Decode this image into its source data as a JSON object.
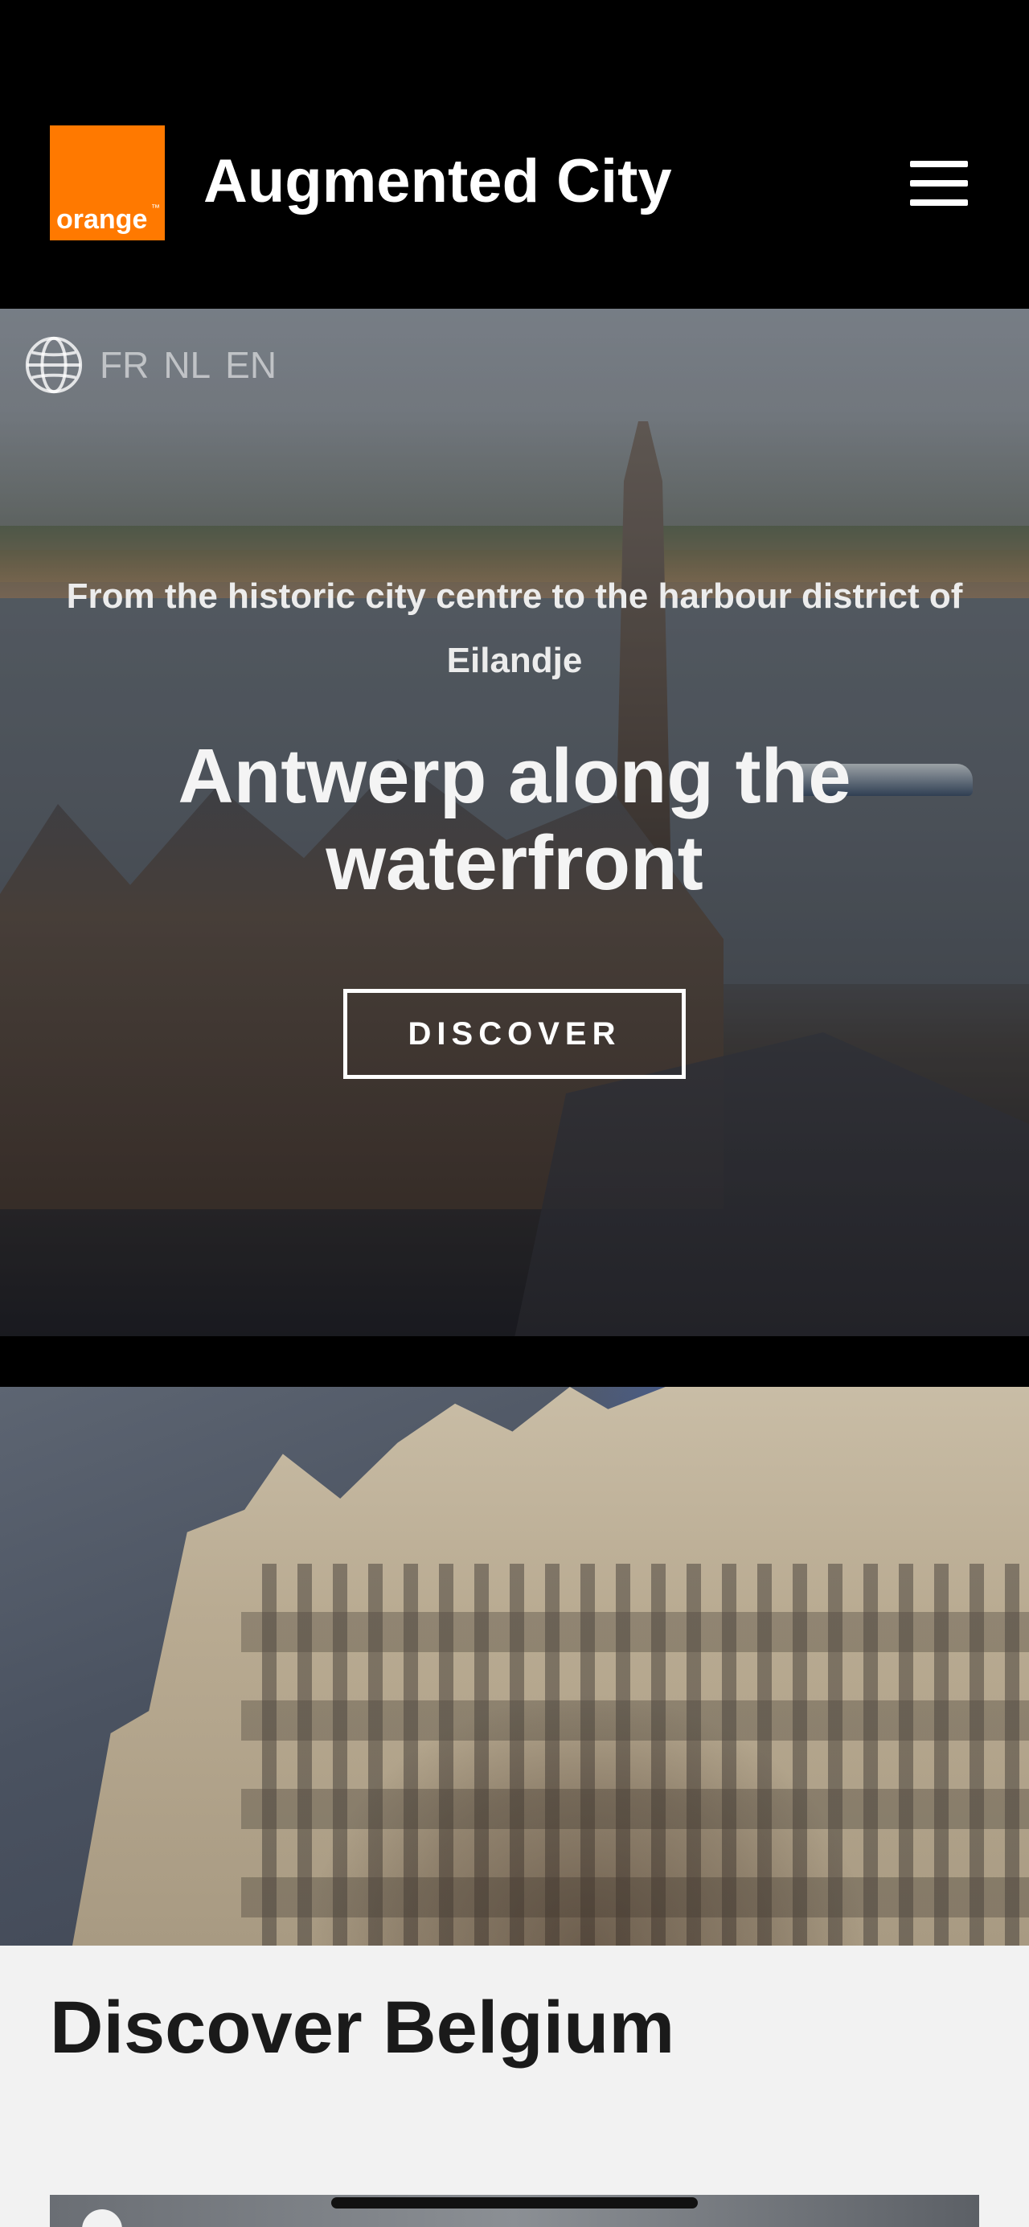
{
  "header": {
    "logo_text": "orange",
    "logo_tm": "™",
    "app_title": "Augmented City",
    "menu_icon": "hamburger-menu-icon"
  },
  "hero": {
    "languages": [
      "FR",
      "NL",
      "EN"
    ],
    "globe_icon": "globe-icon",
    "subtitle": "From the historic city centre to the harbour district of Eilandje",
    "title": "Antwerp along the waterfront",
    "cta_label": "DISCOVER"
  },
  "content": {
    "section_title": "Discover Belgium"
  },
  "colors": {
    "brand_orange": "#ff7900",
    "header_bg": "#000000",
    "content_bg": "#f2f2f2"
  }
}
